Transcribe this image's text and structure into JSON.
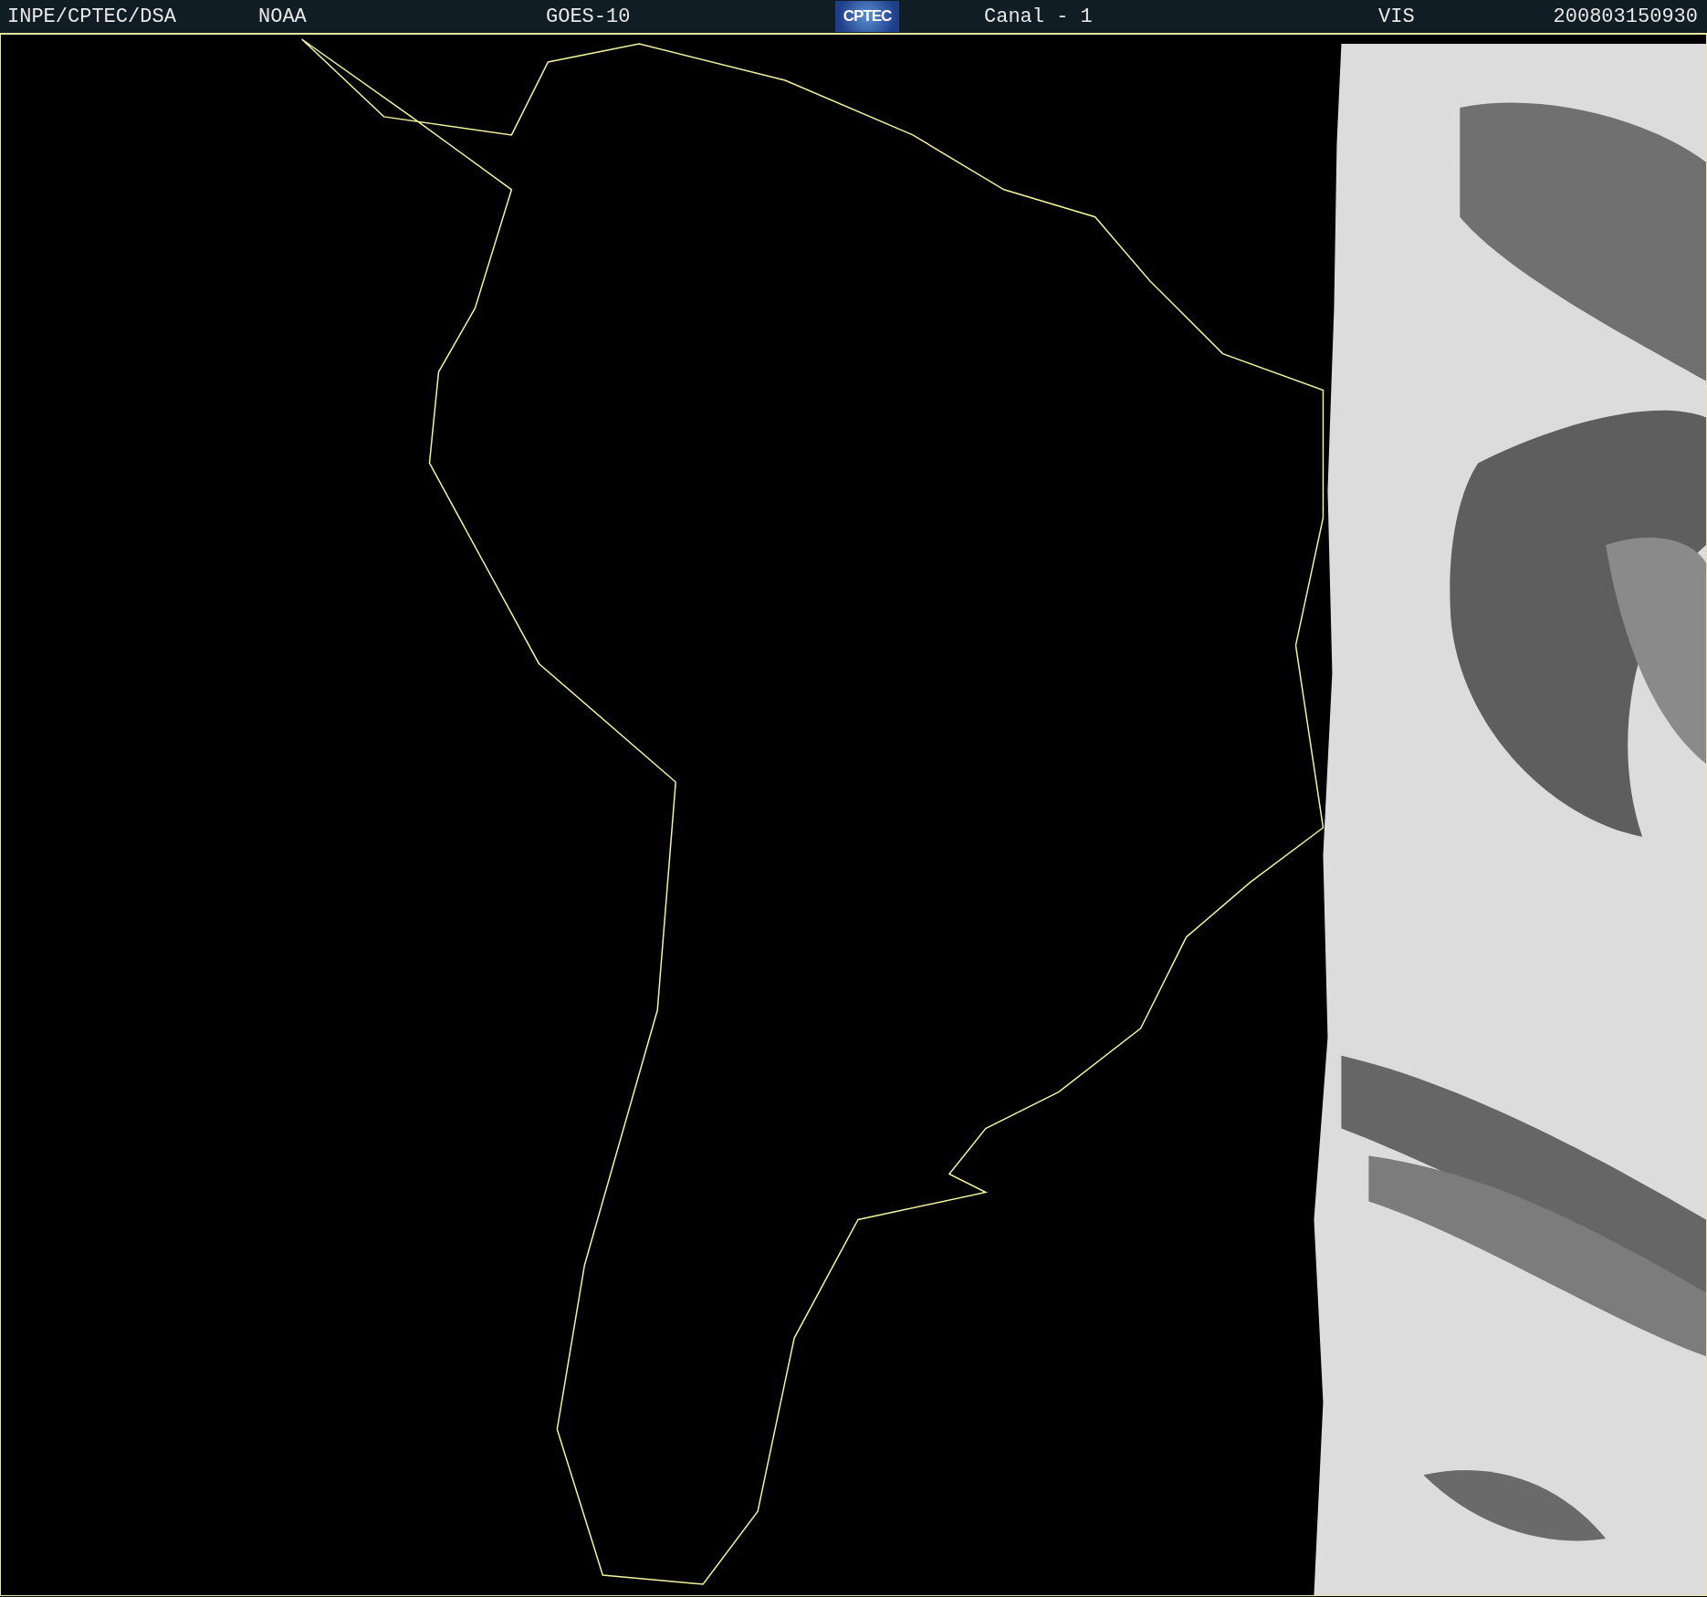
{
  "header": {
    "items": [
      {
        "kind": "text",
        "text": "INPE/CPTEC/DSA"
      },
      {
        "kind": "text",
        "text": "NOAA"
      },
      {
        "kind": "text",
        "text": "GOES-10"
      },
      {
        "kind": "logo",
        "text": "CPTEC"
      },
      {
        "kind": "text",
        "text": "Canal - 1"
      },
      {
        "kind": "text",
        "text": "VIS"
      },
      {
        "kind": "text",
        "text": "200803150930"
      }
    ]
  }
}
